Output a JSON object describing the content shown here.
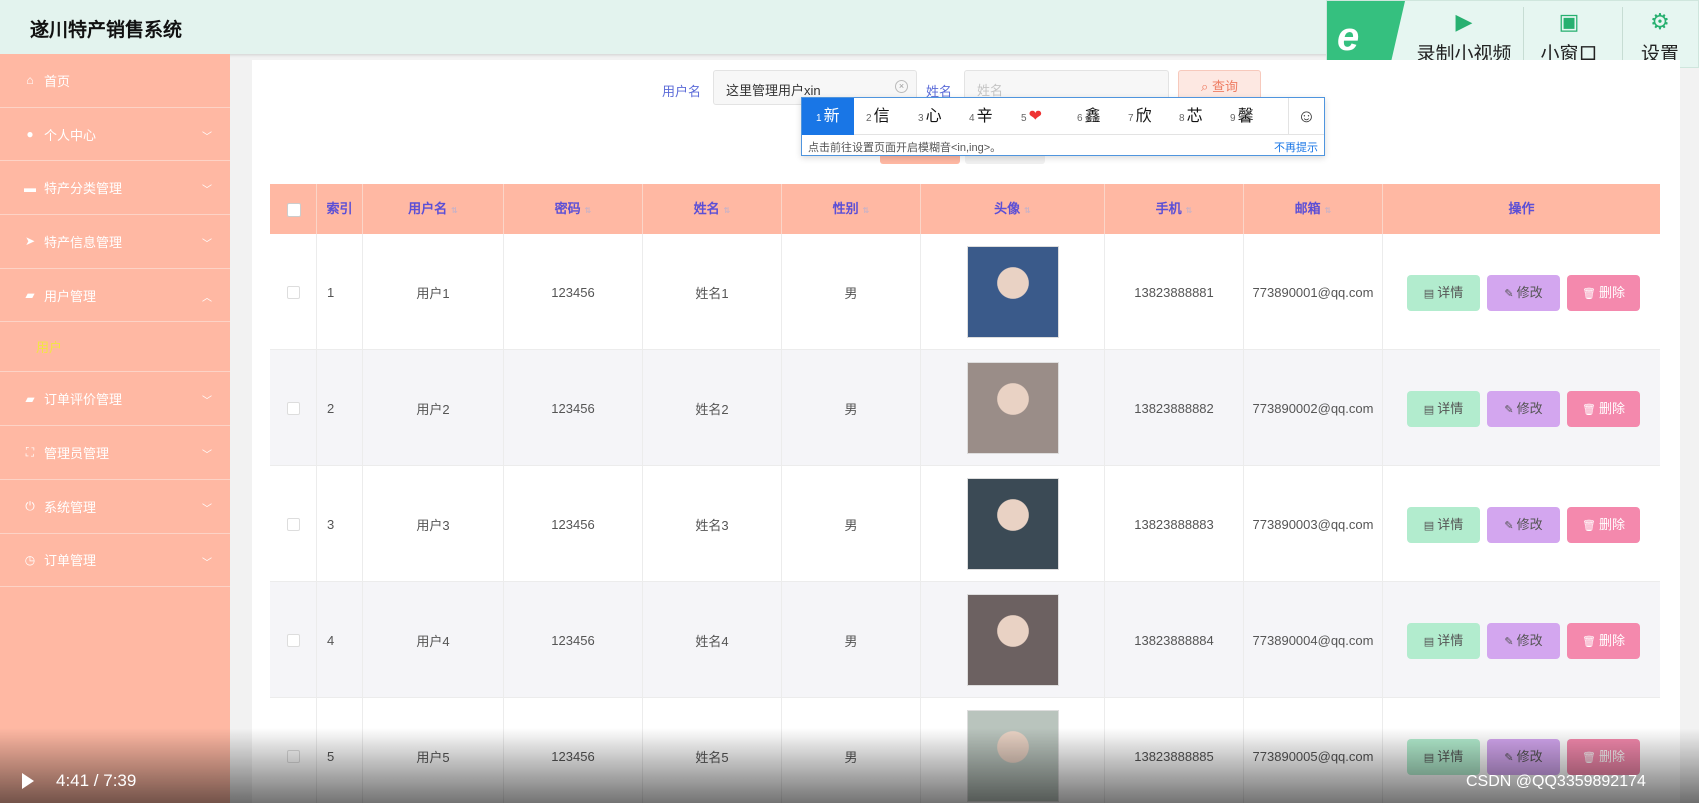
{
  "app": {
    "title": "遂川特产销售系统"
  },
  "toolbar": {
    "logo": "e",
    "record": "录制小视频",
    "mini": "小窗口",
    "settings": "设置"
  },
  "sidebar": {
    "items": [
      {
        "label": "首页",
        "icon": "home-icon"
      },
      {
        "label": "个人中心",
        "icon": "user-icon"
      },
      {
        "label": "特产分类管理",
        "icon": "monitor-icon"
      },
      {
        "label": "特产信息管理",
        "icon": "send-icon"
      },
      {
        "label": "用户管理",
        "icon": "briefcase-icon"
      },
      {
        "label": "订单评价管理",
        "icon": "briefcase-icon"
      },
      {
        "label": "管理员管理",
        "icon": "frame-icon"
      },
      {
        "label": "系统管理",
        "icon": "power-icon"
      },
      {
        "label": "订单管理",
        "icon": "clock-icon"
      }
    ],
    "submenu_active": "用户"
  },
  "search": {
    "username_label": "用户名",
    "username_value": "这里管理用户xin",
    "name_label": "姓名",
    "name_placeholder": "姓名",
    "query_label": "查询"
  },
  "ime": {
    "candidates": [
      {
        "n": "1",
        "c": "新"
      },
      {
        "n": "2",
        "c": "信"
      },
      {
        "n": "3",
        "c": "心"
      },
      {
        "n": "4",
        "c": "辛"
      },
      {
        "n": "5",
        "c": "❤"
      },
      {
        "n": "6",
        "c": "鑫"
      },
      {
        "n": "7",
        "c": "欣"
      },
      {
        "n": "8",
        "c": "芯"
      },
      {
        "n": "9",
        "c": "馨"
      }
    ],
    "hint": "点击前往设置页面开启模糊音<in,ing>。",
    "dismiss": "不再提示"
  },
  "table": {
    "headers": [
      "索引",
      "用户名",
      "密码",
      "姓名",
      "性别",
      "头像",
      "手机",
      "邮箱",
      "操作"
    ],
    "rows": [
      {
        "index": "1",
        "username": "用户1",
        "password": "123456",
        "name": "姓名1",
        "gender": "男",
        "phone": "13823888881",
        "email": "773890001@qq.com",
        "avatar": "#3a5a8a"
      },
      {
        "index": "2",
        "username": "用户2",
        "password": "123456",
        "name": "姓名2",
        "gender": "男",
        "phone": "13823888882",
        "email": "773890002@qq.com",
        "avatar": "#9a8d88"
      },
      {
        "index": "3",
        "username": "用户3",
        "password": "123456",
        "name": "姓名3",
        "gender": "男",
        "phone": "13823888883",
        "email": "773890003@qq.com",
        "avatar": "#3b4a55"
      },
      {
        "index": "4",
        "username": "用户4",
        "password": "123456",
        "name": "姓名4",
        "gender": "男",
        "phone": "13823888884",
        "email": "773890004@qq.com",
        "avatar": "#6c6161"
      },
      {
        "index": "5",
        "username": "用户5",
        "password": "123456",
        "name": "姓名5",
        "gender": "男",
        "phone": "13823888885",
        "email": "773890005@qq.com",
        "avatar": "#b9c4bd"
      }
    ],
    "actions": {
      "detail": "详情",
      "edit": "修改",
      "delete": "删除"
    }
  },
  "video": {
    "time": "4:41 / 7:39",
    "watermark": "CSDN @QQ3359892174"
  }
}
